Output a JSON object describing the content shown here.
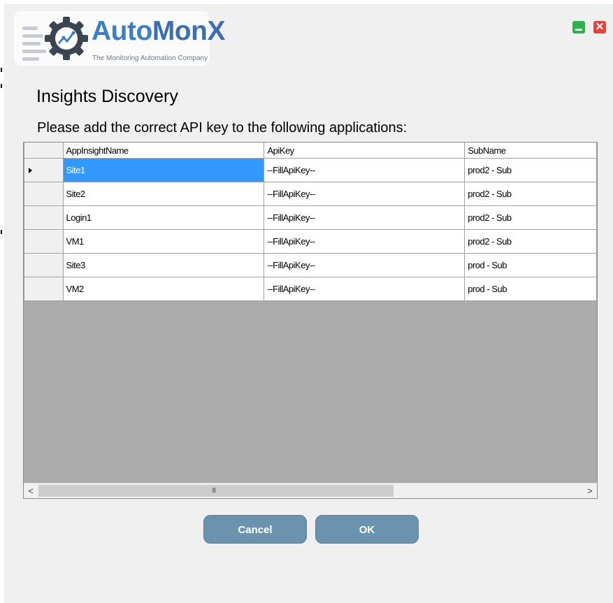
{
  "logo": {
    "word_auto": "Auto",
    "word_monx": "MonX",
    "tagline": "The Monitoring Automation Company"
  },
  "window_controls": {
    "minimize_icon": "minimize-icon",
    "close_icon": "close-icon",
    "close_glyph": "✕"
  },
  "header": {
    "title": "Insights Discovery",
    "subtitle": "Please add the correct API key to the following applications:"
  },
  "grid": {
    "columns": [
      "AppInsightName",
      "ApiKey",
      "SubName"
    ],
    "rows": [
      {
        "name": "Site1",
        "apikey": "--FillApiKey--",
        "sub": "prod2 - Sub"
      },
      {
        "name": "Site2",
        "apikey": "--FillApiKey--",
        "sub": "prod2 - Sub"
      },
      {
        "name": "Login1",
        "apikey": "--FillApiKey--",
        "sub": "prod2 - Sub"
      },
      {
        "name": "VM1",
        "apikey": "--FillApiKey--",
        "sub": "prod2 - Sub"
      },
      {
        "name": "Site3",
        "apikey": "--FillApiKey--",
        "sub": "prod - Sub"
      },
      {
        "name": "VM2",
        "apikey": "--FillApiKey--",
        "sub": "prod - Sub"
      }
    ],
    "selected_row": 0,
    "scroll_left_glyph": "<",
    "scroll_right_glyph": ">",
    "scroll_grip": "III"
  },
  "buttons": {
    "cancel": "Cancel",
    "ok": "OK"
  },
  "colors": {
    "button": "#6b93ad",
    "selection": "#3399ff",
    "brand": "#3d7dc8"
  }
}
